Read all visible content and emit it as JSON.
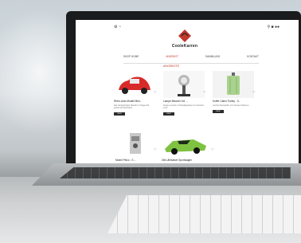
{
  "site": {
    "brand_name": "CooleKarren"
  },
  "nav": {
    "items": [
      "SHOP HOME",
      "ANGEBOT",
      "SAMMLUNG",
      "KONTAKT"
    ]
  },
  "section": {
    "title": "ANGEBOTE"
  },
  "products": [
    {
      "title": "Retro-Auto Modell Mini...",
      "desc": "Das handgefertigte Modell im Vintage-Stil, perfekt als Dekoration.",
      "button": "MEHR"
    },
    {
      "title": "Lampe Mischer Vol ...",
      "desc": "Design-Leuchte mit Metallgehäuse im Industrial-Look.",
      "button": "MEHR"
    },
    {
      "title": "Koffer Cabin Trolley - 3...",
      "desc": "Leichter Reisekoffer mit robustem Rahmen.",
      "button": "MEHR"
    },
    {
      "title": "Model Pelco - S ...",
      "desc": "",
      "button": ""
    },
    {
      "title": "Ziel-Ultimative Sportwagen",
      "desc": "",
      "button": ""
    }
  ],
  "colors": {
    "accent": "#c0392b",
    "product_car": "#d92a2a",
    "product_green": "#7fc241"
  },
  "icons": [
    "user-icon",
    "settings-icon",
    "cart-icon",
    "heart-icon",
    "search-icon"
  ]
}
